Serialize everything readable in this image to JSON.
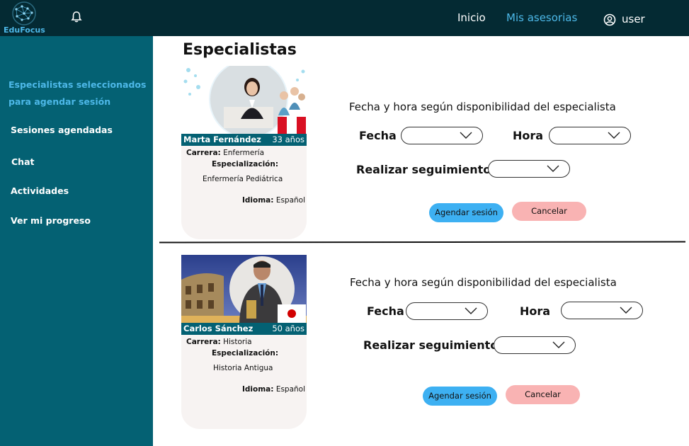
{
  "app": {
    "logo_text": "EduFocus"
  },
  "topbar": {
    "nav": [
      {
        "label": "Inicio"
      },
      {
        "label": "Mis asesorias"
      }
    ],
    "user_label": "user",
    "accent": "#4db8e8",
    "bg": "#042a33"
  },
  "sidebar": {
    "bg": "#046173",
    "items": [
      {
        "label": "Especialistas seleccionados para agendar sesión",
        "active": true
      },
      {
        "label": "Sesiones agendadas"
      },
      {
        "label": "Chat"
      },
      {
        "label": "Actividades"
      },
      {
        "label": "Ver mi progreso"
      }
    ]
  },
  "main": {
    "title": "Especialistas",
    "specialists": [
      {
        "name": "Marta Fernández",
        "age": "33 años",
        "carrera_label": "Carrera:",
        "carrera": "Enfermería",
        "especializacion_label": "Especialización:",
        "especializacion": "Enfermería Pediátrica",
        "idioma_label": "Idioma:",
        "idioma": "Español",
        "flag": "peru-flag",
        "availability_title": "Fecha y hora según disponibilidad del especialista",
        "fecha_label": "Fecha",
        "hora_label": "Hora",
        "seguimiento_label": "Realizar seguimiento",
        "schedule_button": "Agendar sesión",
        "cancel_button": "Cancelar"
      },
      {
        "name": "Carlos Sánchez",
        "age": "50 años",
        "carrera_label": "Carrera:",
        "carrera": "Historia",
        "especializacion_label": "Especialización:",
        "especializacion": "Historia Antigua",
        "idioma_label": "Idioma:",
        "idioma": "Español",
        "flag": "japan-flag",
        "availability_title": "Fecha y hora según disponibilidad del especialista",
        "fecha_label": "Fecha",
        "hora_label": "Hora",
        "seguimiento_label": "Realizar seguimiento",
        "schedule_button": "Agendar sesión",
        "cancel_button": "Cancelar"
      }
    ]
  }
}
